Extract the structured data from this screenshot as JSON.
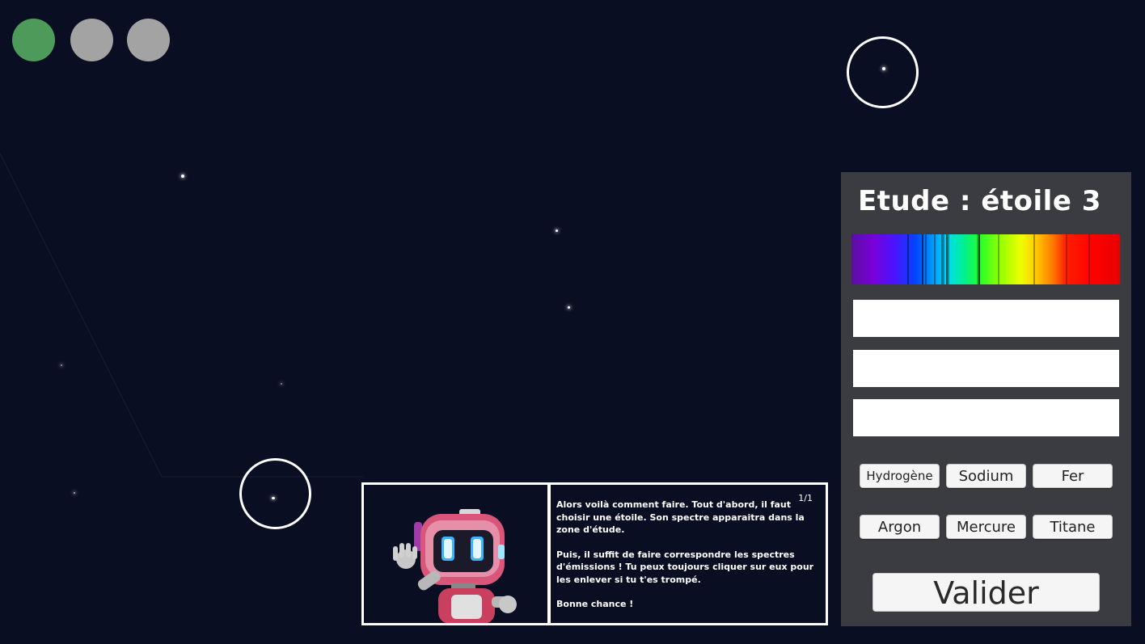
{
  "progress": {
    "dots": [
      {
        "state": "completed",
        "color": "#4e9a5a"
      },
      {
        "state": "pending",
        "color": "#a3a3a3"
      },
      {
        "state": "pending",
        "color": "#a3a3a3"
      }
    ]
  },
  "study_panel": {
    "title": "Etude : étoile 3",
    "spectrum": {
      "type": "emission-spectrum",
      "background": "rainbow"
    },
    "answer_slots": [
      "",
      "",
      ""
    ],
    "elements": [
      {
        "label": "Hydrogène"
      },
      {
        "label": "Sodium"
      },
      {
        "label": "Fer"
      },
      {
        "label": "Argon"
      },
      {
        "label": "Mercure"
      },
      {
        "label": "Titane"
      }
    ],
    "validate_label": "Valider"
  },
  "dialog": {
    "page": "1/1",
    "avatar": "robot-mascot-icon",
    "paragraphs": [
      "Alors voilà comment faire. Tout d'abord, il faut choisir une étoile. Son spectre apparaitra dans la zone d'étude.",
      "Puis, il suffit de faire correspondre les spectres d'émissions ! Tu peux toujours cliquer sur eux pour les enlever si tu t'es trompé.",
      "Bonne chance !"
    ]
  },
  "colors": {
    "sky": "#0a0e22",
    "panel": "#3b3c41",
    "completed": "#4e9a5a",
    "pending": "#a3a3a3"
  }
}
